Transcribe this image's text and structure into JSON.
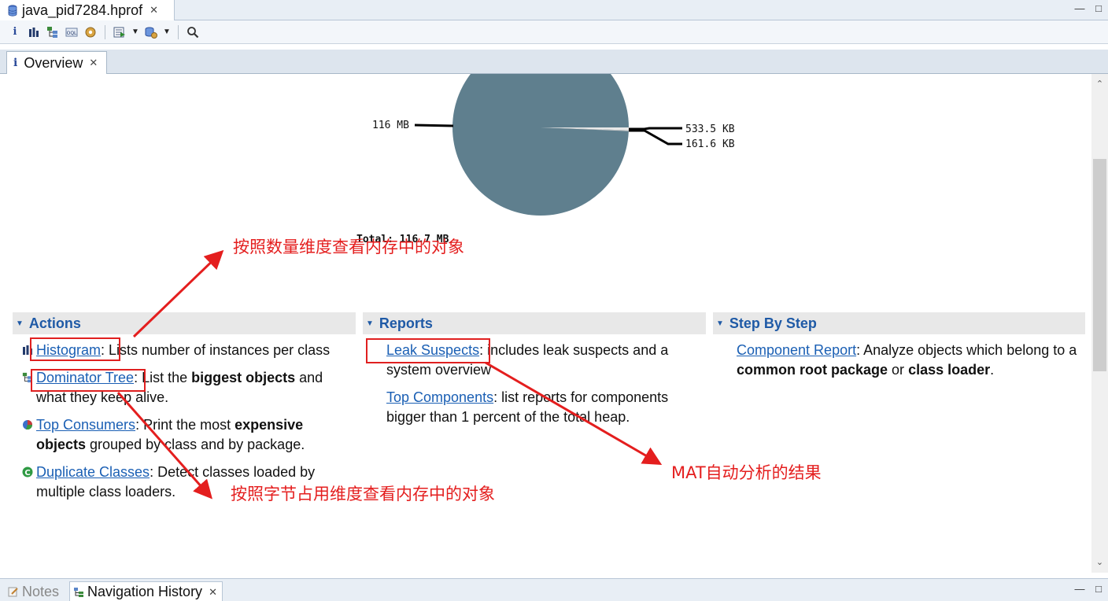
{
  "editor": {
    "file_tab": "java_pid7284.hprof",
    "close_glyph": "✕"
  },
  "toolbar": {
    "icons": [
      "info-icon",
      "histogram-icon",
      "dominator-tree-icon",
      "oql-icon",
      "heap-dump-overview-icon",
      "run-report-icon",
      "query-browser-icon",
      "search-icon"
    ]
  },
  "overview_tab": {
    "label": "Overview"
  },
  "pie": {
    "left_label": "116 MB",
    "right_labels": [
      "533.5 KB",
      "161.6 KB"
    ],
    "total": "Total: 116.7 MB",
    "colors": {
      "main": "#5f7f8e",
      "slice2": "#e8e8e8",
      "slice3": "#c8c8c8"
    }
  },
  "chart_data": {
    "type": "pie",
    "slices": [
      {
        "label": "116 MB",
        "value": 116.0
      },
      {
        "label": "533.5 KB",
        "value": 0.521
      },
      {
        "label": "161.6 KB",
        "value": 0.158
      }
    ],
    "total": "Total: 116.7 MB"
  },
  "sections": {
    "actions": {
      "title": "Actions",
      "items": [
        {
          "link": "Histogram",
          "rest": ": Lists number of instances per class"
        },
        {
          "link": "Dominator Tree",
          "rest_a": ": List the ",
          "bold": "biggest objects",
          "rest_b": " and what they keep alive."
        },
        {
          "link": "Top Consumers",
          "rest_a": ": Print the most ",
          "bold": "expensive objects",
          "rest_b": " grouped by class and by package."
        },
        {
          "link": "Duplicate Classes",
          "rest": ": Detect classes loaded by multiple class loaders."
        }
      ]
    },
    "reports": {
      "title": "Reports",
      "items": [
        {
          "link": "Leak Suspects",
          "rest": ": includes leak suspects and a system overview"
        },
        {
          "link": "Top Components",
          "rest": ": list reports for components bigger than 1 percent of the total heap."
        }
      ]
    },
    "step_by_step": {
      "title": "Step By Step",
      "items": [
        {
          "link": "Component Report",
          "rest_a": ": Analyze objects which belong to a ",
          "bold1": "common root package",
          "rest_b": " or ",
          "bold2": "class loader",
          "rest_c": "."
        }
      ]
    }
  },
  "annotations": {
    "count": "按照数量维度查看内存中的对象",
    "bytes": "按照字节占用维度查看内存中的对象",
    "mat": "MAT自动分析的结果",
    "color": "#e41e1e"
  },
  "bottom_tabs": {
    "notes": "Notes",
    "nav_history": "Navigation History"
  }
}
